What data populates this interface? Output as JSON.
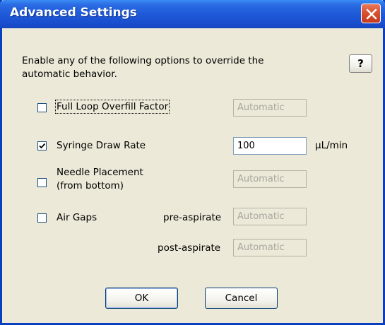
{
  "window": {
    "title": "Advanced Settings"
  },
  "intro_text": "Enable any of the following options to override the automatic behavior.",
  "help_label": "?",
  "options": {
    "full_loop": {
      "label": "Full Loop Overfill Factor",
      "checked": false,
      "value": "Automatic"
    },
    "syringe_draw_rate": {
      "label": "Syringe Draw Rate",
      "checked": true,
      "value": "100",
      "unit": "µL/min"
    },
    "needle_placement": {
      "label_line1": "Needle Placement",
      "label_line2": "(from bottom)",
      "checked": false,
      "value": "Automatic"
    },
    "air_gaps": {
      "label": "Air Gaps",
      "checked": false,
      "pre_label": "pre-aspirate",
      "pre_value": "Automatic",
      "post_label": "post-aspirate",
      "post_value": "Automatic"
    }
  },
  "buttons": {
    "ok": "OK",
    "cancel": "Cancel"
  }
}
